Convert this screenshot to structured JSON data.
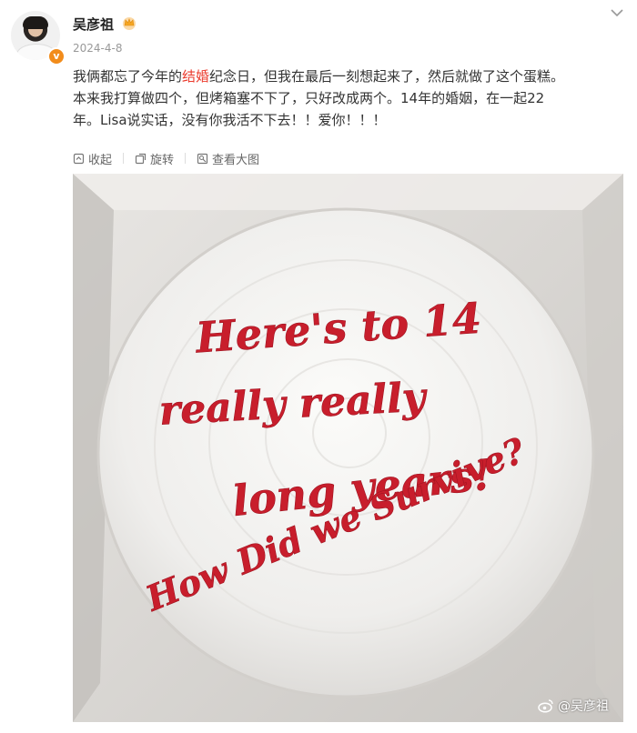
{
  "post": {
    "author": "吴彦祖",
    "date": "2024-4-8",
    "text_lines": [
      {
        "before": "我俩都忘了今年的",
        "highlight": "结婚",
        "after": "纪念日，但我在最后一刻想起来了，然后就做了这个蛋糕。"
      },
      {
        "before": "本来我打算做四个，但烤箱塞不下了，只好改成两个。14年的婚姻，在一起22",
        "highlight": "",
        "after": ""
      },
      {
        "before": "年。Lisa说实话，没有你我活不下去！！爱你！！！",
        "highlight": "",
        "after": ""
      }
    ],
    "verified_icon": "verified-v-icon",
    "crown_icon": "crown-icon",
    "highlight_color": "#eb3c2e"
  },
  "toolbar": {
    "collapse": "收起",
    "rotate": "旋转",
    "view_large": "查看大图"
  },
  "image": {
    "cake_text": [
      "Here's to 14",
      "really really",
      "long years!",
      "How Did we Survive?"
    ],
    "watermark": "@吴彦祖",
    "icing_color": "#c81e2c"
  }
}
